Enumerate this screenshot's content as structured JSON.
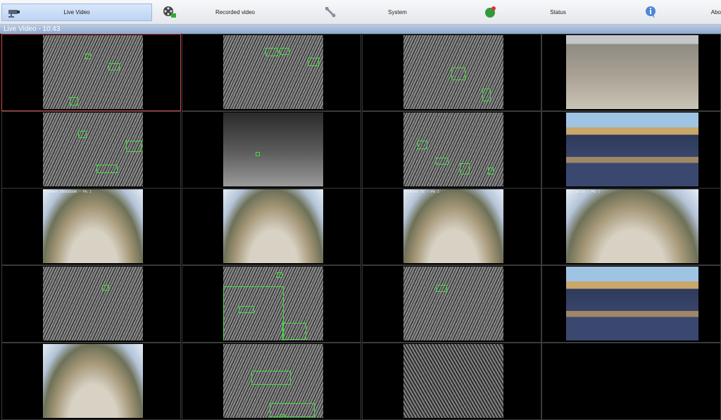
{
  "nav": {
    "tabs": [
      {
        "label": "Live Video",
        "icon": "cctv-camera-icon",
        "active": true
      },
      {
        "label": "Recorded video",
        "icon": "film-reel-icon",
        "active": false
      },
      {
        "label": "System",
        "icon": "wrench-icon",
        "active": false
      },
      {
        "label": "Status",
        "icon": "status-light-icon",
        "active": false
      },
      {
        "label": "Abo",
        "icon": "info-icon",
        "active": false
      }
    ]
  },
  "view": {
    "title": "Live Video - 10:43"
  },
  "cameras": [
    {
      "overlay": "",
      "kind": "thermal"
    },
    {
      "overlay": "",
      "kind": "thermal"
    },
    {
      "overlay": "",
      "kind": "thermal"
    },
    {
      "overlay": "",
      "kind": "daylight-desat"
    },
    {
      "overlay": "",
      "kind": "thermal"
    },
    {
      "overlay": "",
      "kind": "thermal-dark"
    },
    {
      "overlay": "",
      "kind": "thermal"
    },
    {
      "overlay": "",
      "kind": "daylight-solar"
    },
    {
      "overlay": "CAMARA INVERSOR - PG I",
      "kind": "fisheye-day"
    },
    {
      "overlay": "",
      "kind": "fisheye-day"
    },
    {
      "overlay": "CAMARA 7E - PG I",
      "kind": "fisheye-day"
    },
    {
      "overlay": "COLOR 3B - PG I",
      "kind": "fisheye-day"
    },
    {
      "overlay": "",
      "kind": "thermal"
    },
    {
      "overlay": "",
      "kind": "thermal"
    },
    {
      "overlay": "",
      "kind": "thermal"
    },
    {
      "overlay": "",
      "kind": "daylight-solar"
    },
    {
      "overlay": "",
      "kind": "fisheye-day"
    },
    {
      "overlay": "",
      "kind": "thermal"
    },
    {
      "overlay": "",
      "kind": "thermal-noise"
    },
    {
      "overlay": "",
      "kind": "empty"
    }
  ],
  "colors": {
    "detection_box": "#3ee03e",
    "selected_border": "#d04848",
    "title_bar": "#8ea9cf"
  }
}
